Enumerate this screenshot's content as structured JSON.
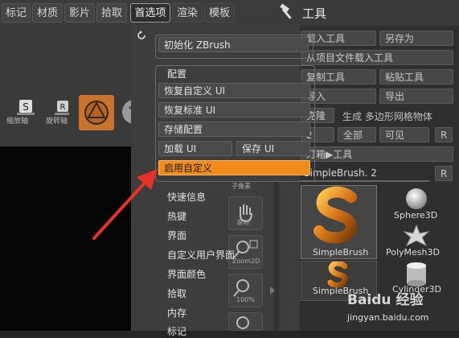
{
  "menubar": {
    "tabs": [
      {
        "label": "标记"
      },
      {
        "label": "材质"
      },
      {
        "label": "影片"
      },
      {
        "label": "拾取"
      },
      {
        "label": "首选项"
      },
      {
        "label": "渲染"
      },
      {
        "label": "模板"
      }
    ],
    "tools_title": "工具"
  },
  "toolbar": {
    "scale_label": "缩放轴",
    "rotate_label": "旋转轴"
  },
  "dropdown": {
    "init_zbrush": "初始化 ZBrush",
    "config_title": "配置",
    "restore_custom_ui": "恢复自定义 UI",
    "restore_standard_ui": "恢复标准 UI",
    "store_config": "存储配置",
    "load_ui": "加载 UI",
    "save_ui": "保存 UI",
    "enable_custom": "启用自定义",
    "list": [
      "快速信息",
      "热键",
      "界面",
      "自定义用户界面",
      "界面颜色",
      "拾取",
      "内存",
      "标记"
    ]
  },
  "mid": {
    "scroll_label": "滚动",
    "zoom_label": "Zoom2D",
    "percent_label": "100%",
    "cut_label": "子像素"
  },
  "tools": {
    "load_tool": "载入工具",
    "save_as": "另存为",
    "load_from_project": "从项目文件载入工具",
    "copy_tool": "复制工具",
    "paste_tool": "粘贴工具",
    "import": "导入",
    "export": "导出",
    "clone": "克隆",
    "make_polymesh": "生成 多边形网格物体",
    "all": "全部",
    "visible": "可见",
    "r": "R",
    "nums_2": "2",
    "lightbox_tools": "灯箱▶工具",
    "current_tool": "SimpleBrush. 2",
    "thumbs": [
      {
        "label": "SimpleBrush"
      },
      {
        "label": "Sphere3D"
      },
      {
        "label": "PolyMesh3D"
      },
      {
        "label": "SimpleBrush"
      },
      {
        "label": "Cylinder3D"
      }
    ]
  },
  "watermark": {
    "brand": "Baidu 经验",
    "url": "jingyan.baidu.com"
  },
  "colors": {
    "accent_orange": "#f08c1e",
    "arrow_red": "#e8302a"
  }
}
